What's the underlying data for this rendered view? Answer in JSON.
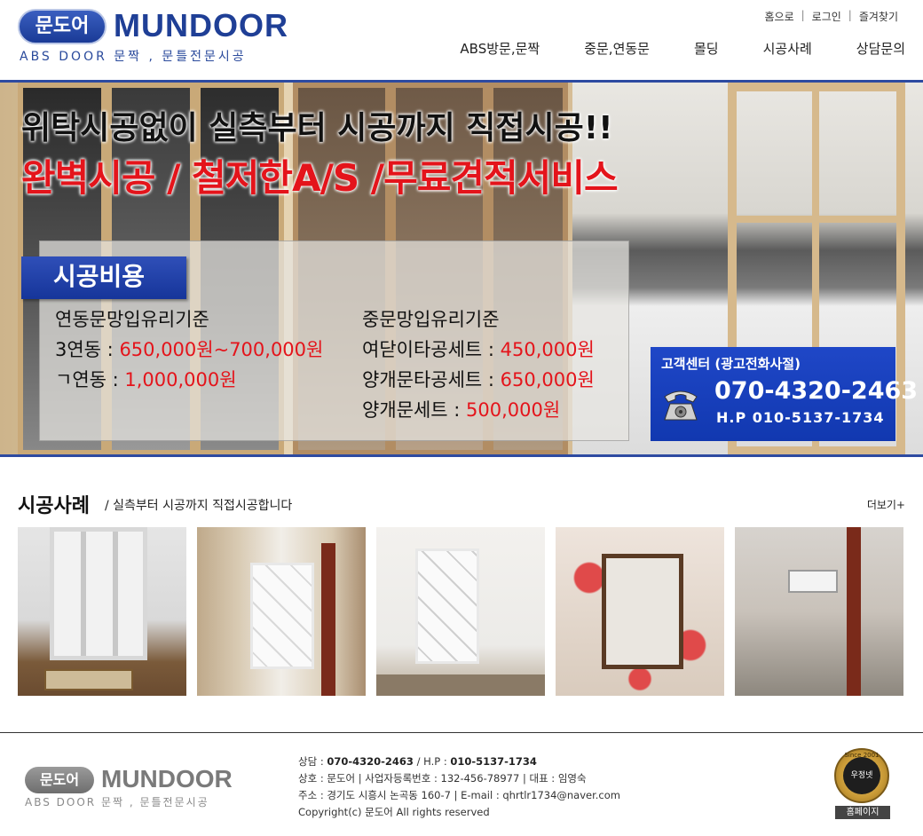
{
  "header": {
    "logo": {
      "badge": "문도어",
      "name": "MUNDOOR",
      "sub": "ABS DOOR 문짝 , 문틀전문시공"
    },
    "util_links": [
      {
        "label": "홈으로"
      },
      {
        "label": "로그인"
      },
      {
        "label": "즐겨찾기"
      }
    ],
    "nav": [
      {
        "label": "ABS방문,문짝"
      },
      {
        "label": "중문,연동문"
      },
      {
        "label": "몰딩"
      },
      {
        "label": "시공사례"
      },
      {
        "label": "상담문의"
      }
    ],
    "accent_color": "#2d4aa1"
  },
  "hero": {
    "headline": "위탁시공없이 실측부터 시공까지 직접시공!!",
    "subheadline": "완벽시공 / 철저한A/S /무료견적서비스",
    "price_tab": "시공비용",
    "left_column": {
      "title": "연동문망입유리기준",
      "rows": [
        {
          "label": "3연동 : ",
          "value": "650,000원~700,000원"
        },
        {
          "label": "ㄱ연동 : ",
          "value": "1,000,000원"
        }
      ]
    },
    "right_column": {
      "title": "중문망입유리기준",
      "rows": [
        {
          "label": "여닫이타공세트 : ",
          "value": "450,000원"
        },
        {
          "label": "양개문타공세트 : ",
          "value": "650,000원"
        },
        {
          "label": "양개문세트 : ",
          "value": "500,000원"
        }
      ]
    },
    "customer_center": {
      "title": "고객센터 (광고전화사절)",
      "tel": "070-4320-2463",
      "hp": "H.P 010-5137-1734",
      "icon": "telephone-icon"
    }
  },
  "gallery": {
    "title": "시공사례",
    "subtitle": "/ 실측부터 시공까지 직접시공합니다",
    "more_label": "더보기+",
    "items": [
      {
        "icon": "construction-photo"
      },
      {
        "icon": "construction-photo"
      },
      {
        "icon": "construction-photo"
      },
      {
        "icon": "construction-photo"
      },
      {
        "icon": "construction-photo"
      }
    ]
  },
  "footer": {
    "logo": {
      "badge": "문도어",
      "name": "MUNDOOR",
      "sub": "ABS DOOR 문짝 , 문틀전문시공"
    },
    "lines": {
      "consult_label": "상담 : ",
      "consult_tel": "070-4320-2463",
      "hp_label": " / H.P : ",
      "hp_value": "010-5137-1734",
      "company": "상호 : 문도어 | 사업자등록번호 : 132-456-78977 | 대표 : 임영숙",
      "address": "주소 : 경기도 시흥시 논곡동 160-7 | E-mail : qhrtlr1734@naver.com",
      "copyright": "Copyright(c) 문도어 All rights reserved"
    },
    "seal": {
      "top": "Since 2001",
      "center": "우정넷"
    },
    "home_button": "홈페이지"
  }
}
